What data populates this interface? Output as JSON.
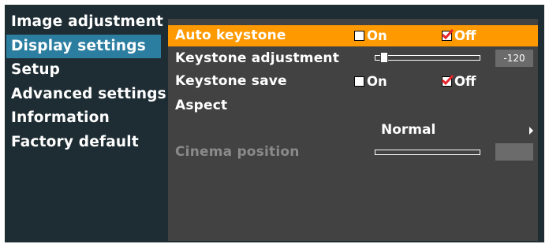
{
  "sidebar": {
    "items": [
      {
        "label": "Image adjustment",
        "active": false
      },
      {
        "label": "Display settings",
        "active": true
      },
      {
        "label": "Setup",
        "active": false
      },
      {
        "label": "Advanced settings",
        "active": false
      },
      {
        "label": "Information",
        "active": false
      },
      {
        "label": "Factory default",
        "active": false
      }
    ]
  },
  "panel": {
    "auto_keystone": {
      "label": "Auto keystone",
      "on_label": "On",
      "off_label": "Off",
      "selected": "Off"
    },
    "keystone_adjustment": {
      "label": "Keystone adjustment",
      "value": "-120"
    },
    "keystone_save": {
      "label": "Keystone save",
      "on_label": "On",
      "off_label": "Off",
      "selected": "Off"
    },
    "aspect": {
      "label": "Aspect",
      "value": "Normal"
    },
    "cinema_position": {
      "label": "Cinema position",
      "enabled": false
    }
  },
  "colors": {
    "highlight": "#ff9900",
    "sidebar_active": "#2c7ea1",
    "panel_bg": "#424242",
    "frame_bg": "#1e2d33",
    "check_red": "#e8242c"
  },
  "icons": {
    "checkbox_checked": "red-checkmark-icon",
    "aspect_arrow": "triangle-right-icon"
  }
}
